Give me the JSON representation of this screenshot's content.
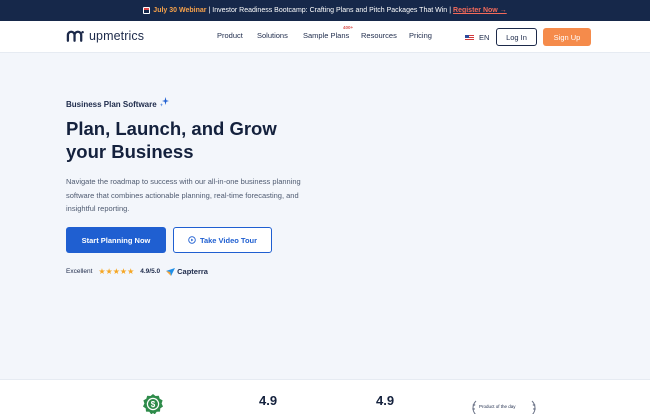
{
  "announcement": {
    "date": "July 30 Webinar",
    "separator": "|",
    "text": "Investor Readiness Bootcamp: Crafting Plans and Pitch Packages That Win",
    "cta": "Register Now →"
  },
  "nav": {
    "brand": "upmetrics",
    "menu": [
      {
        "label": "Product"
      },
      {
        "label": "Solutions"
      },
      {
        "label": "Sample Plans",
        "badge": "400+"
      },
      {
        "label": "Resources"
      },
      {
        "label": "Pricing"
      }
    ],
    "language": "EN",
    "login_label": "Log In",
    "signup_label": "Sign Up"
  },
  "hero": {
    "eyebrow": "Business Plan Software",
    "title": "Plan, Launch, and Grow your Business",
    "description": "Navigate the roadmap to success with our all-in-one business planning software that combines actionable planning, real-time forecasting, and insightful reporting.",
    "primary_cta": "Start Planning Now",
    "secondary_cta": "Take Video Tour"
  },
  "rating": {
    "label": "Excellent",
    "stars": "★★★★★",
    "score": "4.9/5.0",
    "source": "Capterra"
  },
  "stats": {
    "rating_a": "4.9",
    "rating_b": "4.9",
    "award": "Product of the day"
  },
  "colors": {
    "primary": "#1f5fd1",
    "accent": "#f58b4b",
    "banner": "#16284a",
    "star": "#f5a623"
  }
}
